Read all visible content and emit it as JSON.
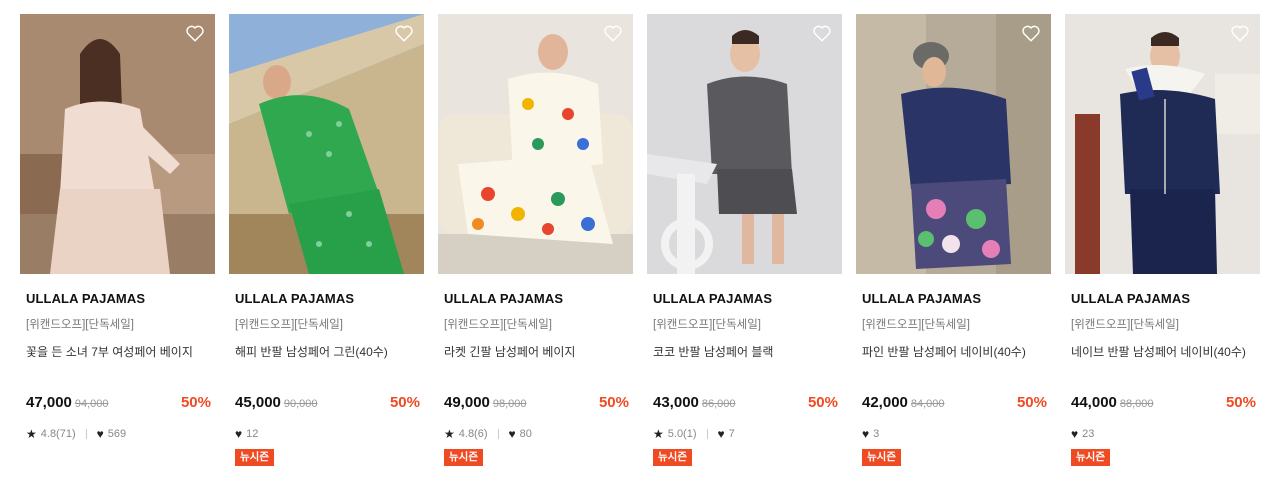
{
  "products": [
    {
      "brand": "ULLALA PAJAMAS",
      "tags": "[위캔드오프][단독세일]",
      "name": "꽃을 든 소녀 7부 여성페어 베이지",
      "price": "47,000",
      "original_price": "94,000",
      "discount": "50%",
      "rating": "4.8(71)",
      "likes": "569",
      "badge": null,
      "image": "model-beige-pajama"
    },
    {
      "brand": "ULLALA PAJAMAS",
      "tags": "[위캔드오프][단독세일]",
      "name": "해피 반팔 남성페어 그린(40수)",
      "price": "45,000",
      "original_price": "90,000",
      "discount": "50%",
      "rating": null,
      "likes": "12",
      "badge": "뉴시즌",
      "image": "model-green-pajama"
    },
    {
      "brand": "ULLALA PAJAMAS",
      "tags": "[위캔드오프][단독세일]",
      "name": "라켓 긴팔 남성페어 베이지",
      "price": "49,000",
      "original_price": "98,000",
      "discount": "50%",
      "rating": "4.8(6)",
      "likes": "80",
      "badge": "뉴시즌",
      "image": "model-colorful-pajama"
    },
    {
      "brand": "ULLALA PAJAMAS",
      "tags": "[위캔드오프][단독세일]",
      "name": "코코 반팔 남성페어 블랙",
      "price": "43,000",
      "original_price": "86,000",
      "discount": "50%",
      "rating": "5.0(1)",
      "likes": "7",
      "badge": "뉴시즌",
      "image": "model-check-pajama"
    },
    {
      "brand": "ULLALA PAJAMAS",
      "tags": "[위캔드오프][단독세일]",
      "name": "파인 반팔 남성페어 네이비(40수)",
      "price": "42,000",
      "original_price": "84,000",
      "discount": "50%",
      "rating": null,
      "likes": "3",
      "badge": "뉴시즌",
      "image": "model-navy-floral-pajama"
    },
    {
      "brand": "ULLALA PAJAMAS",
      "tags": "[위캔드오프][단독세일]",
      "name": "네이브 반팔 남성페어 네이비(40수)",
      "price": "44,000",
      "original_price": "88,000",
      "discount": "50%",
      "rating": null,
      "likes": "23",
      "badge": "뉴시즌",
      "image": "model-navy-pajama"
    }
  ],
  "colors": {
    "accent": "#ef4a22",
    "text": "#111111",
    "muted": "#999999"
  }
}
